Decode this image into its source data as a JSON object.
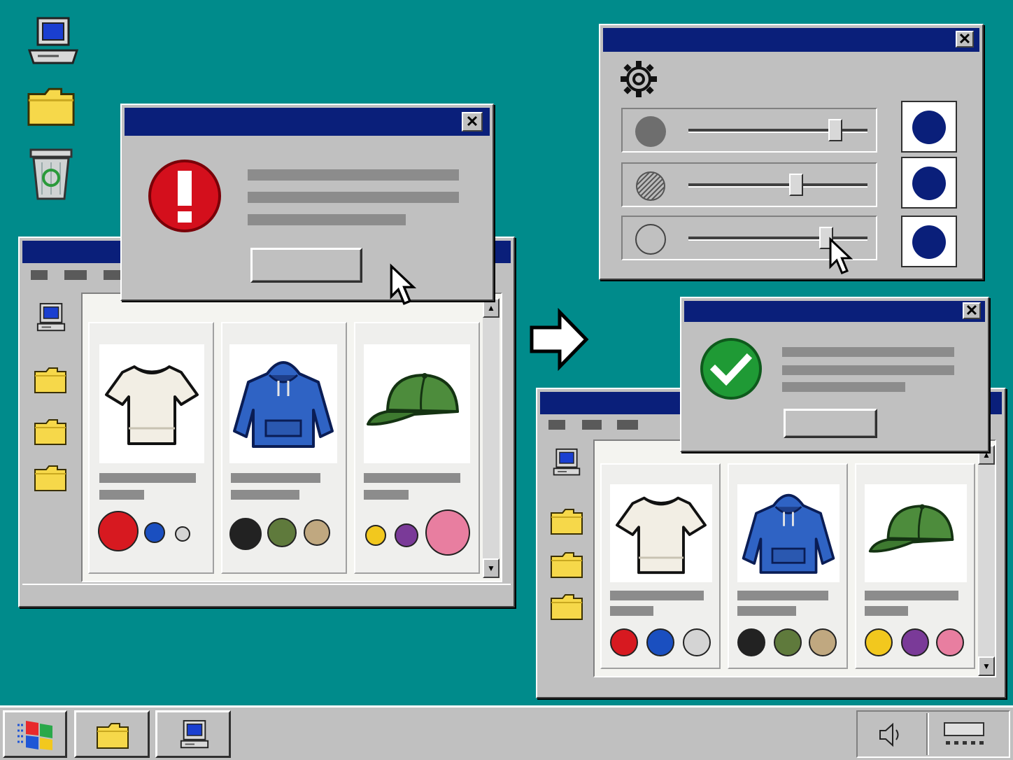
{
  "desktop": {
    "background": "#008b8b",
    "icons": [
      "my-computer-icon",
      "folder-icon",
      "recycle-bin-icon"
    ]
  },
  "colors": {
    "titlebar": "#0a1f7a",
    "chrome": "#c0c0c0",
    "error": "#d40f1c",
    "success": "#1f9a35"
  },
  "error_dialog": {
    "icon": "error-exclamation-icon",
    "close_glyph": "✕"
  },
  "success_dialog": {
    "icon": "checkmark-icon",
    "close_glyph": "✕"
  },
  "settings_dialog": {
    "icon": "gear-icon",
    "close_glyph": "✕",
    "sliders": [
      {
        "icon": "solid-circle-icon",
        "value": 0.82
      },
      {
        "icon": "hatched-circle-icon",
        "value": 0.6
      },
      {
        "icon": "outline-circle-icon",
        "value": 0.77
      }
    ]
  },
  "shop_window": {
    "products": [
      {
        "item": "t-shirt",
        "swatches": [
          "#d71920",
          "#1a4fc0",
          "#d4d4d4"
        ]
      },
      {
        "item": "hoodie",
        "swatches": [
          "#222222",
          "#5f7a3c",
          "#c0a880"
        ]
      },
      {
        "item": "cap",
        "swatches": [
          "#f2c81e",
          "#7a3a98",
          "#e87ea0"
        ]
      }
    ]
  },
  "shop_window_2": {
    "products": [
      {
        "item": "t-shirt",
        "swatches": [
          "#d71920",
          "#1a4fc0",
          "#d4d4d4"
        ]
      },
      {
        "item": "hoodie",
        "swatches": [
          "#222222",
          "#5f7a3c",
          "#c0a880"
        ]
      },
      {
        "item": "cap",
        "swatches": [
          "#f2c81e",
          "#7a3a98",
          "#e87ea0"
        ]
      }
    ]
  },
  "scroll": {
    "up_glyph": "▲",
    "down_glyph": "▼"
  },
  "taskbar": {
    "buttons": [
      "start-logo-icon",
      "folder-icon",
      "my-computer-icon"
    ],
    "tray": [
      "speaker-icon",
      "keyboard-icon"
    ]
  }
}
